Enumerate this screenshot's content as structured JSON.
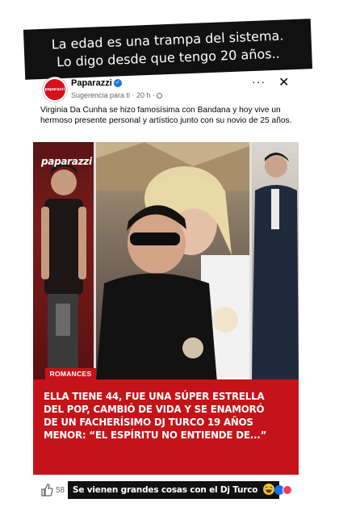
{
  "banner": {
    "line1": "La edad es una trampa del sistema.",
    "line2": "Lo digo desde que tengo 20 años.."
  },
  "post": {
    "page_name": "Paparazzi",
    "logo_text": "paparazzi",
    "meta": "Sugerencia para ti · 20 h ·",
    "more_label": "···",
    "close_label": "✕",
    "text": "Virginia Da Cunha se hizo famosísima con Bandana y hoy vive un hermoso presente personal y artístico junto con su novio de 25 años.",
    "image": {
      "watermark": "paparazzi",
      "section_tag": "ROMANCES",
      "headline": "ELLA TIENE 44, FUE UNA SÚPER ESTRELLA DEL POP, CAMBIÓ DE VIDA Y SE ENAMORÓ DE UN FACHERÍSIMO DJ TURCO 19 AÑOS MENOR: “EL ESPÍRITU NO ENTIENDE DE...”"
    },
    "like_count": "58",
    "caption": "Se vienen grandes cosas con el Dj Turco"
  },
  "colors": {
    "brand_red": "#c4141a",
    "facebook_blue": "#1b74e4",
    "love_red": "#f33e58"
  },
  "icons": [
    "verified-icon",
    "globe-icon",
    "like-icon",
    "laughing-emoji-icon",
    "like-reaction-icon",
    "love-reaction-icon"
  ]
}
